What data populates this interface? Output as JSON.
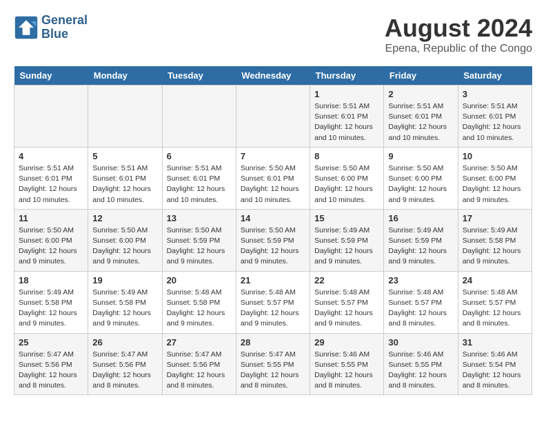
{
  "header": {
    "logo_line1": "General",
    "logo_line2": "Blue",
    "title": "August 2024",
    "subtitle": "Epena, Republic of the Congo"
  },
  "calendar": {
    "days_of_week": [
      "Sunday",
      "Monday",
      "Tuesday",
      "Wednesday",
      "Thursday",
      "Friday",
      "Saturday"
    ],
    "weeks": [
      [
        {
          "day": "",
          "info": ""
        },
        {
          "day": "",
          "info": ""
        },
        {
          "day": "",
          "info": ""
        },
        {
          "day": "",
          "info": ""
        },
        {
          "day": "1",
          "info": "Sunrise: 5:51 AM\nSunset: 6:01 PM\nDaylight: 12 hours and 10 minutes."
        },
        {
          "day": "2",
          "info": "Sunrise: 5:51 AM\nSunset: 6:01 PM\nDaylight: 12 hours and 10 minutes."
        },
        {
          "day": "3",
          "info": "Sunrise: 5:51 AM\nSunset: 6:01 PM\nDaylight: 12 hours and 10 minutes."
        }
      ],
      [
        {
          "day": "4",
          "info": "Sunrise: 5:51 AM\nSunset: 6:01 PM\nDaylight: 12 hours and 10 minutes."
        },
        {
          "day": "5",
          "info": "Sunrise: 5:51 AM\nSunset: 6:01 PM\nDaylight: 12 hours and 10 minutes."
        },
        {
          "day": "6",
          "info": "Sunrise: 5:51 AM\nSunset: 6:01 PM\nDaylight: 12 hours and 10 minutes."
        },
        {
          "day": "7",
          "info": "Sunrise: 5:50 AM\nSunset: 6:01 PM\nDaylight: 12 hours and 10 minutes."
        },
        {
          "day": "8",
          "info": "Sunrise: 5:50 AM\nSunset: 6:00 PM\nDaylight: 12 hours and 10 minutes."
        },
        {
          "day": "9",
          "info": "Sunrise: 5:50 AM\nSunset: 6:00 PM\nDaylight: 12 hours and 9 minutes."
        },
        {
          "day": "10",
          "info": "Sunrise: 5:50 AM\nSunset: 6:00 PM\nDaylight: 12 hours and 9 minutes."
        }
      ],
      [
        {
          "day": "11",
          "info": "Sunrise: 5:50 AM\nSunset: 6:00 PM\nDaylight: 12 hours and 9 minutes."
        },
        {
          "day": "12",
          "info": "Sunrise: 5:50 AM\nSunset: 6:00 PM\nDaylight: 12 hours and 9 minutes."
        },
        {
          "day": "13",
          "info": "Sunrise: 5:50 AM\nSunset: 5:59 PM\nDaylight: 12 hours and 9 minutes."
        },
        {
          "day": "14",
          "info": "Sunrise: 5:50 AM\nSunset: 5:59 PM\nDaylight: 12 hours and 9 minutes."
        },
        {
          "day": "15",
          "info": "Sunrise: 5:49 AM\nSunset: 5:59 PM\nDaylight: 12 hours and 9 minutes."
        },
        {
          "day": "16",
          "info": "Sunrise: 5:49 AM\nSunset: 5:59 PM\nDaylight: 12 hours and 9 minutes."
        },
        {
          "day": "17",
          "info": "Sunrise: 5:49 AM\nSunset: 5:58 PM\nDaylight: 12 hours and 9 minutes."
        }
      ],
      [
        {
          "day": "18",
          "info": "Sunrise: 5:49 AM\nSunset: 5:58 PM\nDaylight: 12 hours and 9 minutes."
        },
        {
          "day": "19",
          "info": "Sunrise: 5:49 AM\nSunset: 5:58 PM\nDaylight: 12 hours and 9 minutes."
        },
        {
          "day": "20",
          "info": "Sunrise: 5:48 AM\nSunset: 5:58 PM\nDaylight: 12 hours and 9 minutes."
        },
        {
          "day": "21",
          "info": "Sunrise: 5:48 AM\nSunset: 5:57 PM\nDaylight: 12 hours and 9 minutes."
        },
        {
          "day": "22",
          "info": "Sunrise: 5:48 AM\nSunset: 5:57 PM\nDaylight: 12 hours and 9 minutes."
        },
        {
          "day": "23",
          "info": "Sunrise: 5:48 AM\nSunset: 5:57 PM\nDaylight: 12 hours and 8 minutes."
        },
        {
          "day": "24",
          "info": "Sunrise: 5:48 AM\nSunset: 5:57 PM\nDaylight: 12 hours and 8 minutes."
        }
      ],
      [
        {
          "day": "25",
          "info": "Sunrise: 5:47 AM\nSunset: 5:56 PM\nDaylight: 12 hours and 8 minutes."
        },
        {
          "day": "26",
          "info": "Sunrise: 5:47 AM\nSunset: 5:56 PM\nDaylight: 12 hours and 8 minutes."
        },
        {
          "day": "27",
          "info": "Sunrise: 5:47 AM\nSunset: 5:56 PM\nDaylight: 12 hours and 8 minutes."
        },
        {
          "day": "28",
          "info": "Sunrise: 5:47 AM\nSunset: 5:55 PM\nDaylight: 12 hours and 8 minutes."
        },
        {
          "day": "29",
          "info": "Sunrise: 5:46 AM\nSunset: 5:55 PM\nDaylight: 12 hours and 8 minutes."
        },
        {
          "day": "30",
          "info": "Sunrise: 5:46 AM\nSunset: 5:55 PM\nDaylight: 12 hours and 8 minutes."
        },
        {
          "day": "31",
          "info": "Sunrise: 5:46 AM\nSunset: 5:54 PM\nDaylight: 12 hours and 8 minutes."
        }
      ]
    ]
  }
}
